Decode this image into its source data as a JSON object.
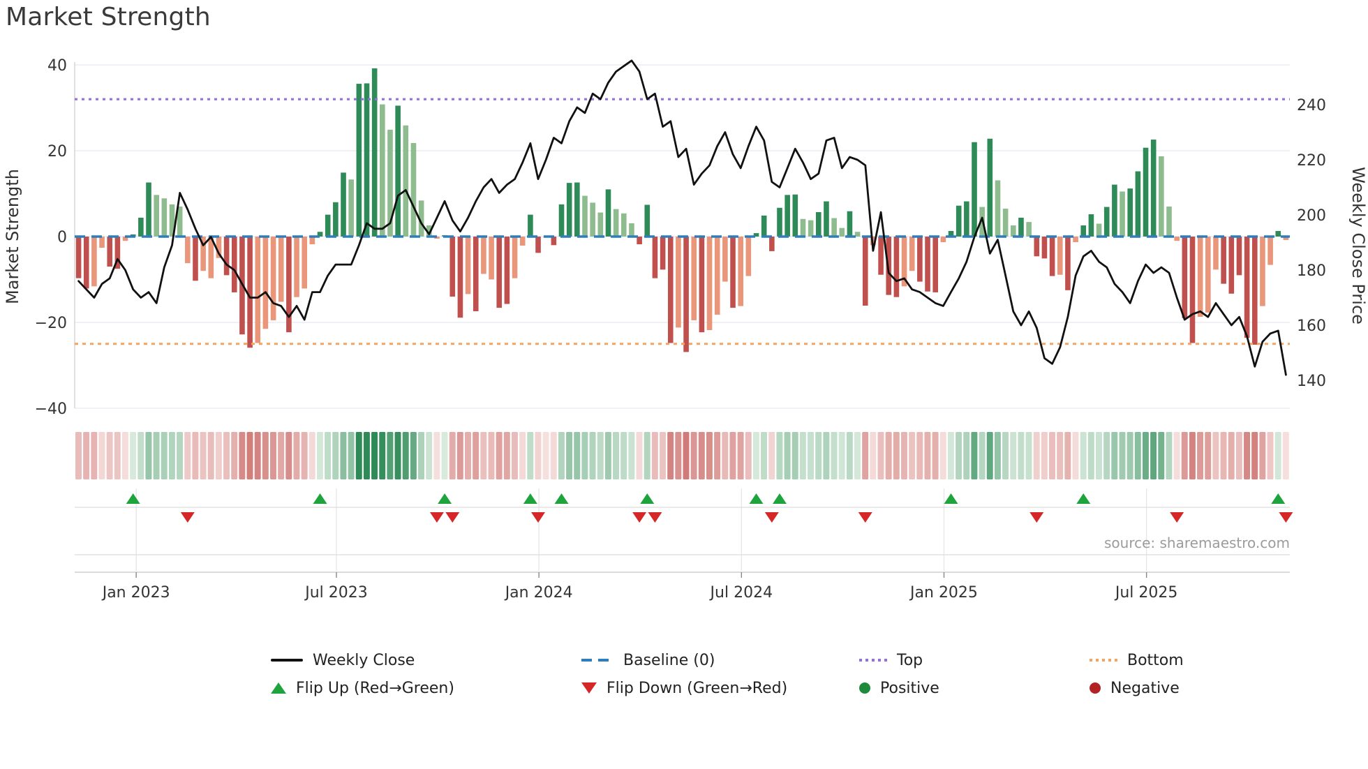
{
  "title": "Market Strength",
  "source": "source: sharemaestro.com",
  "axes": {
    "left_label": "Market Strength",
    "right_label": "Weekly Close Price",
    "left_ticks": [
      40,
      20,
      0,
      -20,
      -40
    ],
    "left_range": [
      -40,
      40
    ],
    "right_ticks": [
      240,
      220,
      200,
      180,
      160,
      140
    ],
    "x_ticks": [
      {
        "label": "Jan 2023",
        "week": 7.4
      },
      {
        "label": "Jul 2023",
        "week": 33.1
      },
      {
        "label": "Jan 2024",
        "week": 59.1
      },
      {
        "label": "Jul 2024",
        "week": 85.1
      },
      {
        "label": "Jan 2025",
        "week": 111.1
      },
      {
        "label": "Jul 2025",
        "week": 137.1
      }
    ]
  },
  "legend": {
    "weekly_close": "Weekly Close",
    "baseline": "Baseline (0)",
    "top": "Top",
    "bottom": "Bottom",
    "flip_up": "Flip Up (Red→Green)",
    "flip_down": "Flip Down (Green→Red)",
    "positive": "Positive",
    "negative": "Negative"
  },
  "colors": {
    "bar_pos_dark": "#2E8B57",
    "bar_pos_light": "#8FBC8F",
    "bar_neg_dark": "#C0504D",
    "bar_neg_light": "#E9967A",
    "baseline": "#2E7EBD",
    "top_line": "#9370DB",
    "bottom_line": "#F4A460",
    "price_line": "#111111",
    "flip_up": "#1FA33C",
    "flip_down": "#D62728",
    "grid": "#E7E7F0",
    "spine": "#CFCFCF",
    "tick_text": "#333333"
  },
  "chart_data": {
    "type": "bar",
    "description": "Weekly market-strength histogram (green positive / red negative, dark vs light tone) with weekly close price line, reference lines, strength heatmap strip and flip event markers",
    "n_weeks": 156,
    "baseline_value": 0,
    "top_value": 32,
    "bottom_value": -25,
    "strength": [
      -9.7,
      -12.1,
      -11.6,
      -2.6,
      -7,
      -7.5,
      -1,
      0.5,
      4.4,
      12.6,
      9.7,
      8.9,
      7.5,
      7,
      -6.2,
      -10.3,
      -8,
      -9.7,
      -5,
      -9,
      -13,
      -22.8,
      -25.9,
      -24.8,
      -21.5,
      -19.5,
      -15.2,
      -22.3,
      -14.1,
      -12.1,
      -1.8,
      1.1,
      5.1,
      8,
      14.9,
      13.3,
      35.6,
      35.7,
      39.2,
      30.8,
      24.9,
      30.5,
      25.9,
      21.8,
      8.4,
      2.6,
      -0.5,
      0.3,
      -14,
      -18.9,
      -13.4,
      -17.4,
      -8.7,
      -10,
      -16.6,
      -15.7,
      -9.7,
      -2.1,
      5.1,
      -3.8,
      -0.2,
      -2,
      7.5,
      12.5,
      12.6,
      9.5,
      7.9,
      5.6,
      11,
      6.4,
      5.4,
      3.1,
      -1.8,
      7.4,
      -9.7,
      -7.7,
      -24.8,
      -21.2,
      -26.9,
      -19.5,
      -22.3,
      -21.8,
      -18.2,
      -10.5,
      -16.6,
      -16.2,
      -9.2,
      0.8,
      4.9,
      -3.4,
      6.7,
      9.7,
      9.8,
      4.1,
      3.8,
      5.7,
      8.2,
      4.3,
      2,
      5.9,
      1.1,
      -16.1,
      -2,
      -8.9,
      -13.6,
      -14.1,
      -11.6,
      -8,
      -10.5,
      -12.8,
      -13,
      -1.3,
      1.3,
      7.2,
      8.2,
      22,
      6.9,
      22.8,
      13.1,
      6.5,
      2.6,
      4.4,
      3.4,
      -4.6,
      -5.1,
      -9.2,
      -8.9,
      -12.5,
      -1.3,
      2.6,
      5.2,
      3,
      6.9,
      12.1,
      10.5,
      11.2,
      15.2,
      20.7,
      22.6,
      18.7,
      7,
      -1,
      -19,
      -24.8,
      -18.7,
      -17.7,
      -7.7,
      -11,
      -13.3,
      -9,
      -23.6,
      -25.2,
      -16.2,
      -6.6,
      1.3,
      -0.8
    ],
    "tone": "ddllddldddllllldlllddddlllldlllddddldddlldlllllddd ldllddllddlddddllldllldddddldldllldllddddddllddlldldldddlldddlddddldllldldddldlddlddlddddlllddllldddddlldl",
    "price": [
      176,
      173,
      170,
      175,
      177,
      184,
      180,
      173,
      170,
      172,
      168,
      181,
      189,
      208,
      202,
      195,
      189,
      192,
      186,
      182,
      180,
      175,
      170,
      170,
      172,
      168,
      167,
      163,
      167,
      162,
      172,
      172,
      178,
      182,
      182,
      182,
      189,
      197,
      195,
      195,
      197,
      207,
      209,
      203,
      197,
      193,
      199,
      205,
      198,
      194,
      199,
      205,
      210,
      213,
      208,
      211,
      213,
      219,
      226,
      213,
      220,
      228,
      226,
      234,
      239,
      237,
      244,
      242,
      248,
      252,
      254,
      256,
      252,
      242,
      244,
      232,
      234,
      221,
      224,
      211,
      215,
      218,
      225,
      230,
      222,
      217,
      225,
      232,
      227,
      212,
      210,
      217,
      224,
      219,
      213,
      215,
      227,
      228,
      217,
      221,
      220,
      218,
      187,
      201,
      179,
      176,
      177,
      173,
      172,
      170,
      168,
      167,
      172,
      177,
      183,
      192,
      199,
      186,
      191,
      178,
      165,
      160,
      165,
      159,
      148,
      146,
      152,
      163,
      178,
      185,
      187,
      183,
      181,
      175,
      172,
      168,
      176,
      182,
      179,
      181,
      179,
      170,
      162,
      164,
      165,
      163,
      168,
      164,
      160,
      163,
      156,
      145,
      154,
      157,
      158,
      142
    ],
    "flip_up_weeks": [
      7,
      31,
      47,
      58,
      62,
      73,
      87,
      90,
      112,
      129,
      154
    ],
    "flip_down_weeks": [
      14,
      46,
      48,
      59,
      72,
      74,
      89,
      101,
      123,
      141,
      155
    ],
    "heatmap": "derived: cell color = strength sign/magnitude, saturation = |strength|/32"
  }
}
